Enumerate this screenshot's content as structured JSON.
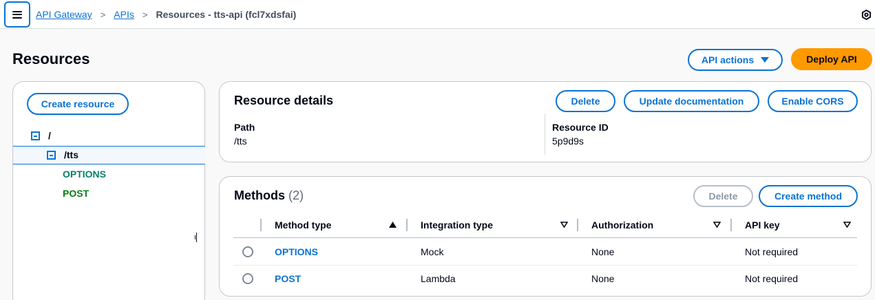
{
  "breadcrumb": {
    "items": [
      "API Gateway",
      "APIs"
    ],
    "separator": ">",
    "current": "Resources - tts-api (fcl7xdsfai)"
  },
  "icons": {
    "menu": "hamburger-menu-icon",
    "settings": "settings-icon"
  },
  "page": {
    "title": "Resources",
    "api_actions_label": "API actions",
    "deploy_label": "Deploy API"
  },
  "resource_tree": {
    "create_label": "Create resource",
    "nodes": [
      {
        "path": "/",
        "expanded": true
      },
      {
        "path": "/tts",
        "expanded": true,
        "selected": true
      }
    ],
    "methods": [
      "OPTIONS",
      "POST"
    ]
  },
  "resource_details": {
    "title": "Resource details",
    "delete_label": "Delete",
    "update_doc_label": "Update documentation",
    "enable_cors_label": "Enable CORS",
    "path_label": "Path",
    "path_value": "/tts",
    "id_label": "Resource ID",
    "id_value": "5p9d9s"
  },
  "methods": {
    "title": "Methods",
    "count": "(2)",
    "delete_label": "Delete",
    "create_label": "Create method",
    "columns": [
      "Method type",
      "Integration type",
      "Authorization",
      "API key"
    ],
    "sort": {
      "column": "Method type",
      "direction": "ascending"
    },
    "rows": [
      {
        "method": "OPTIONS",
        "integration": "Mock",
        "authorization": "None",
        "api_key": "Not required"
      },
      {
        "method": "POST",
        "integration": "Lambda",
        "authorization": "None",
        "api_key": "Not required"
      }
    ]
  },
  "colors": {
    "link": "#0972d3",
    "primary_button": "#ff9900",
    "options_method": "#067f68",
    "post_method": "#037f0c"
  }
}
